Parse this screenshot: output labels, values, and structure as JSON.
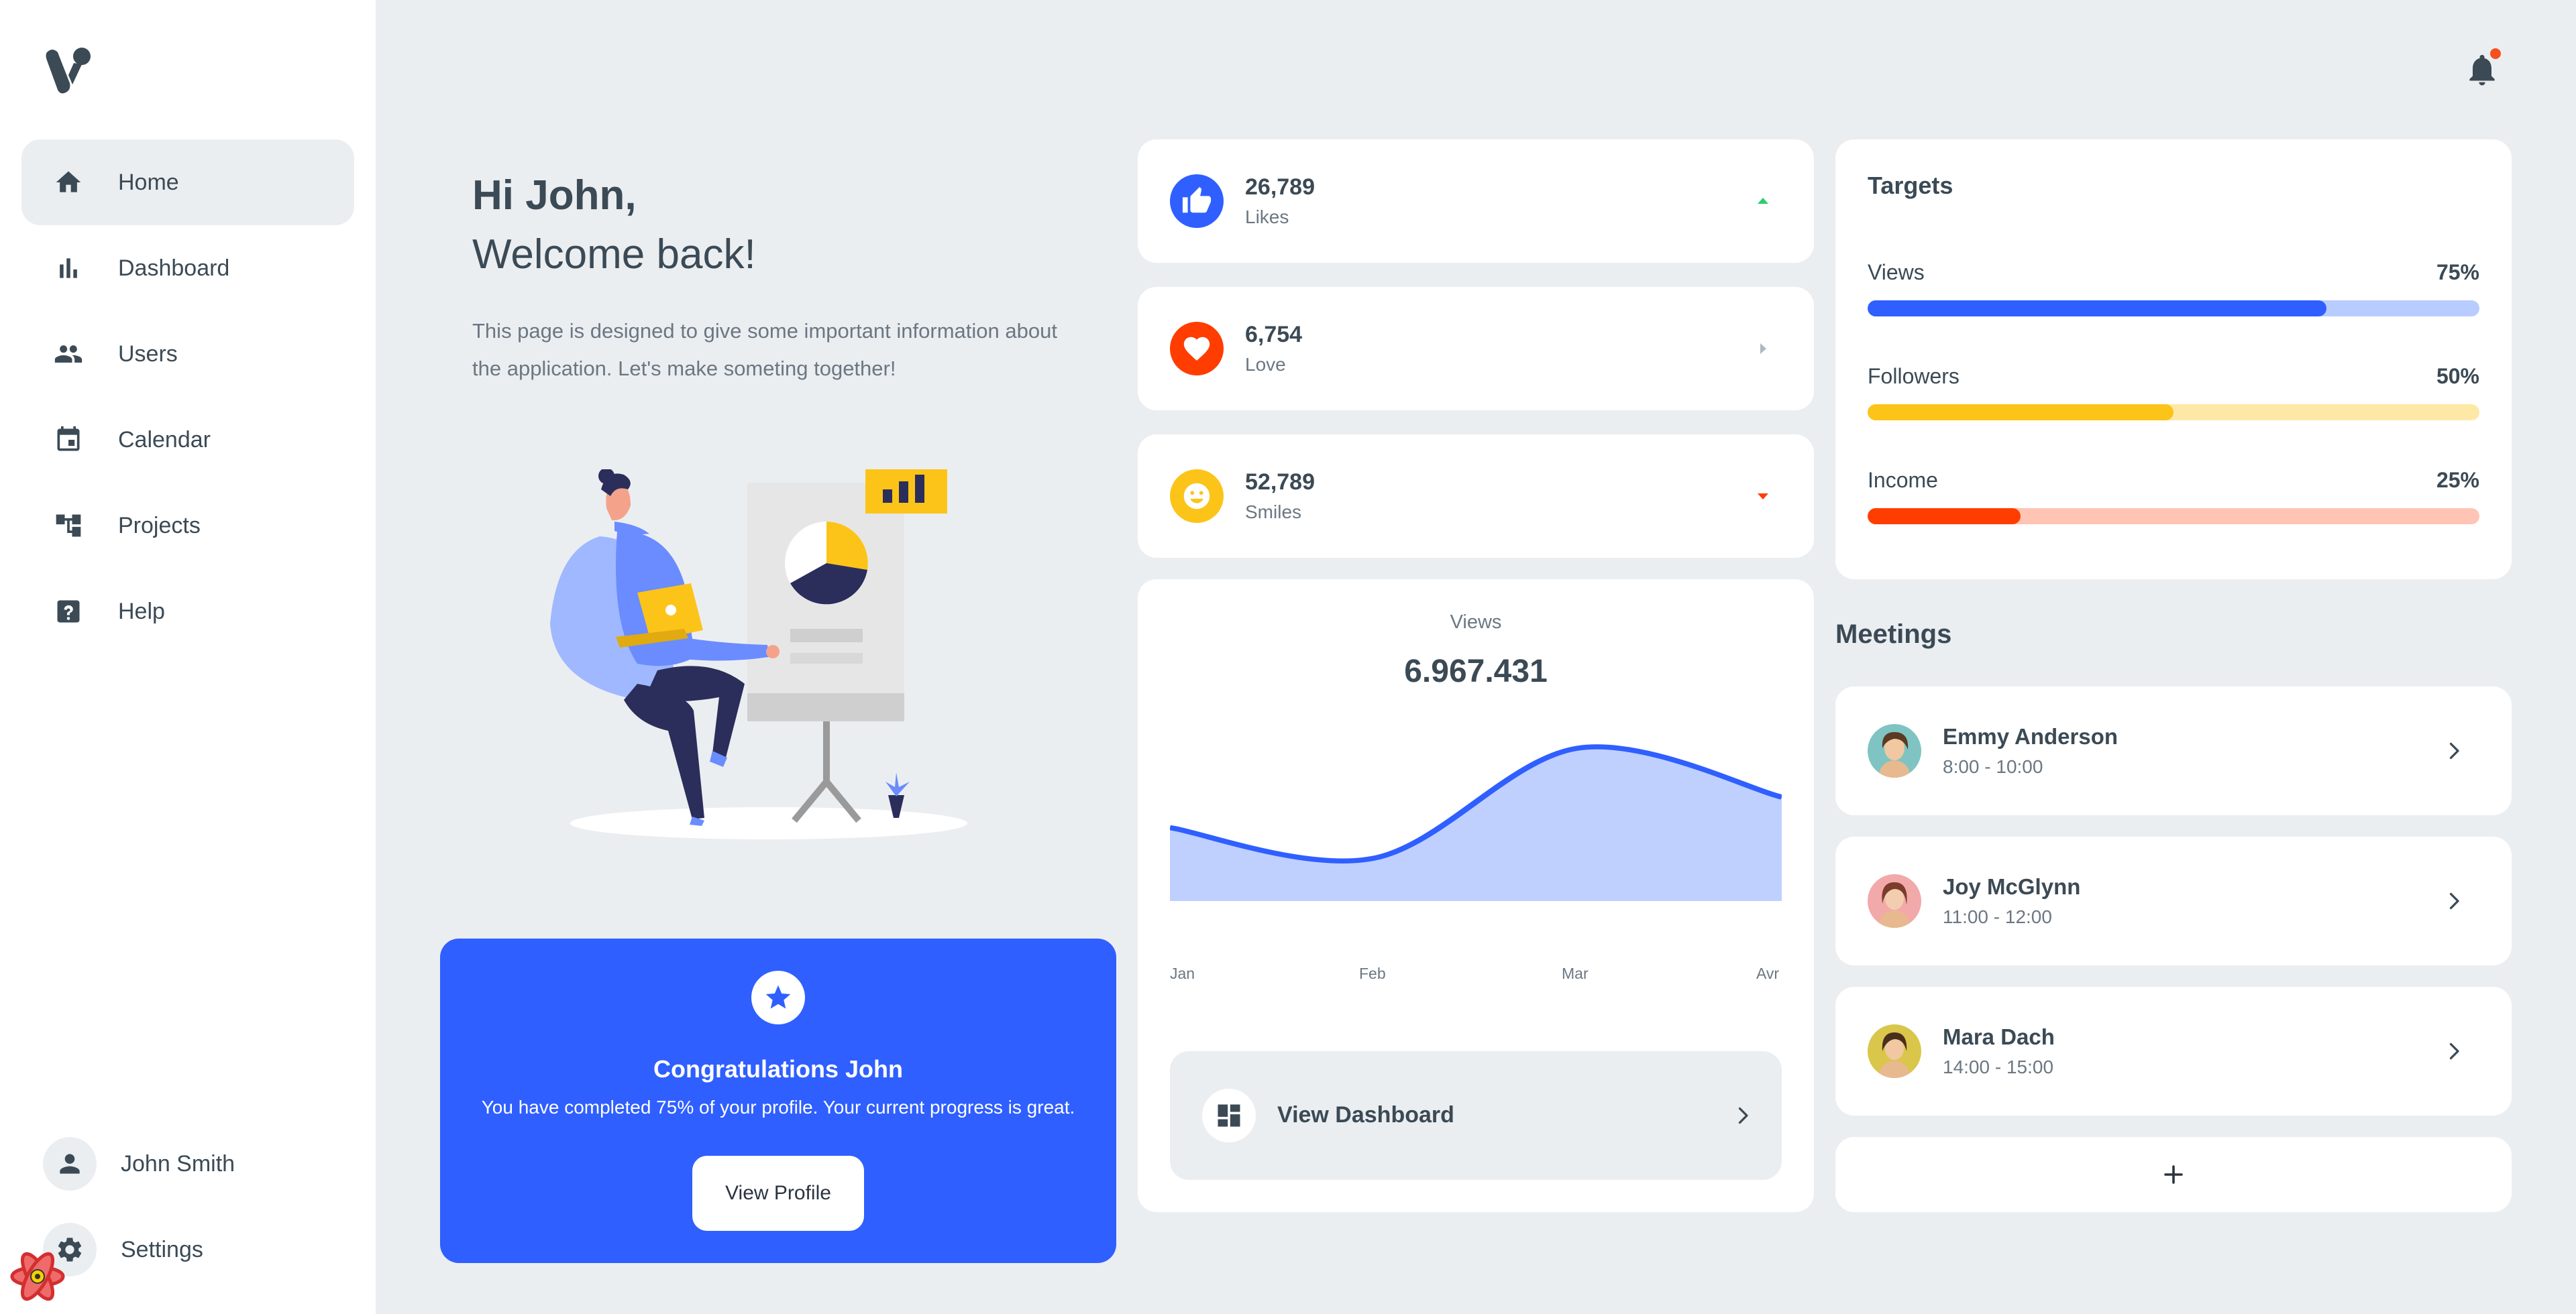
{
  "sidebar": {
    "items": [
      {
        "label": "Home",
        "icon": "home-icon",
        "active": true
      },
      {
        "label": "Dashboard",
        "icon": "bar-chart-icon"
      },
      {
        "label": "Users",
        "icon": "users-icon"
      },
      {
        "label": "Calendar",
        "icon": "calendar-icon"
      },
      {
        "label": "Projects",
        "icon": "projects-icon"
      },
      {
        "label": "Help",
        "icon": "help-icon"
      }
    ],
    "user_name": "John Smith",
    "settings_label": "Settings"
  },
  "greeting": {
    "title": "Hi John,",
    "subtitle": "Welcome back!",
    "description": "This page is designed to give some important information about the application. Let's make someting together!"
  },
  "congrats": {
    "title": "Congratulations John",
    "text": "You have completed 75% of your profile. Your current progress is great.",
    "button_label": "View Profile"
  },
  "stats": [
    {
      "value": "26,789",
      "label": "Likes",
      "icon": "thumbs-up-icon",
      "color": "#2f5fff",
      "trend": "up",
      "trend_color": "#2ecc71"
    },
    {
      "value": "6,754",
      "label": "Love",
      "icon": "heart-icon",
      "color": "#ff3d00",
      "trend": "flat",
      "trend_color": "#b0b8bf"
    },
    {
      "value": "52,789",
      "label": "Smiles",
      "icon": "smile-icon",
      "color": "#fcc419",
      "trend": "down",
      "trend_color": "#ff3d00"
    }
  ],
  "views": {
    "title": "Views",
    "total": "6.967.431",
    "button_label": "View Dashboard"
  },
  "chart_data": {
    "type": "area",
    "title": "Views",
    "categories": [
      "Jan",
      "Feb",
      "Mar",
      "Avr"
    ],
    "x": [
      0,
      1,
      2,
      3
    ],
    "series": [
      {
        "values": [
          48,
          28,
          100,
          68
        ]
      }
    ],
    "fill_color": "#bfd0ff",
    "line_color": "#2f5fff",
    "grid": false
  },
  "targets": {
    "title": "Targets",
    "items": [
      {
        "name": "Views",
        "percent_label": "75%",
        "fraction": 0.75,
        "color": "#2f5fff",
        "track": "#b9ccff"
      },
      {
        "name": "Followers",
        "percent_label": "50%",
        "fraction": 0.5,
        "color": "#fcc419",
        "track": "#fde8a6"
      },
      {
        "name": "Income",
        "percent_label": "25%",
        "fraction": 0.25,
        "color": "#ff3d00",
        "track": "#ffc4b3"
      }
    ]
  },
  "meetings": {
    "title": "Meetings",
    "items": [
      {
        "name": "Emmy Anderson",
        "time": "8:00 - 10:00",
        "avatar_bg": "#7fc4c2"
      },
      {
        "name": "Joy McGlynn",
        "time": "11:00 - 12:00",
        "avatar_bg": "#f2a9a9"
      },
      {
        "name": "Mara Dach",
        "time": "14:00 - 15:00",
        "avatar_bg": "#d9c64a"
      }
    ],
    "add_label": "+"
  }
}
